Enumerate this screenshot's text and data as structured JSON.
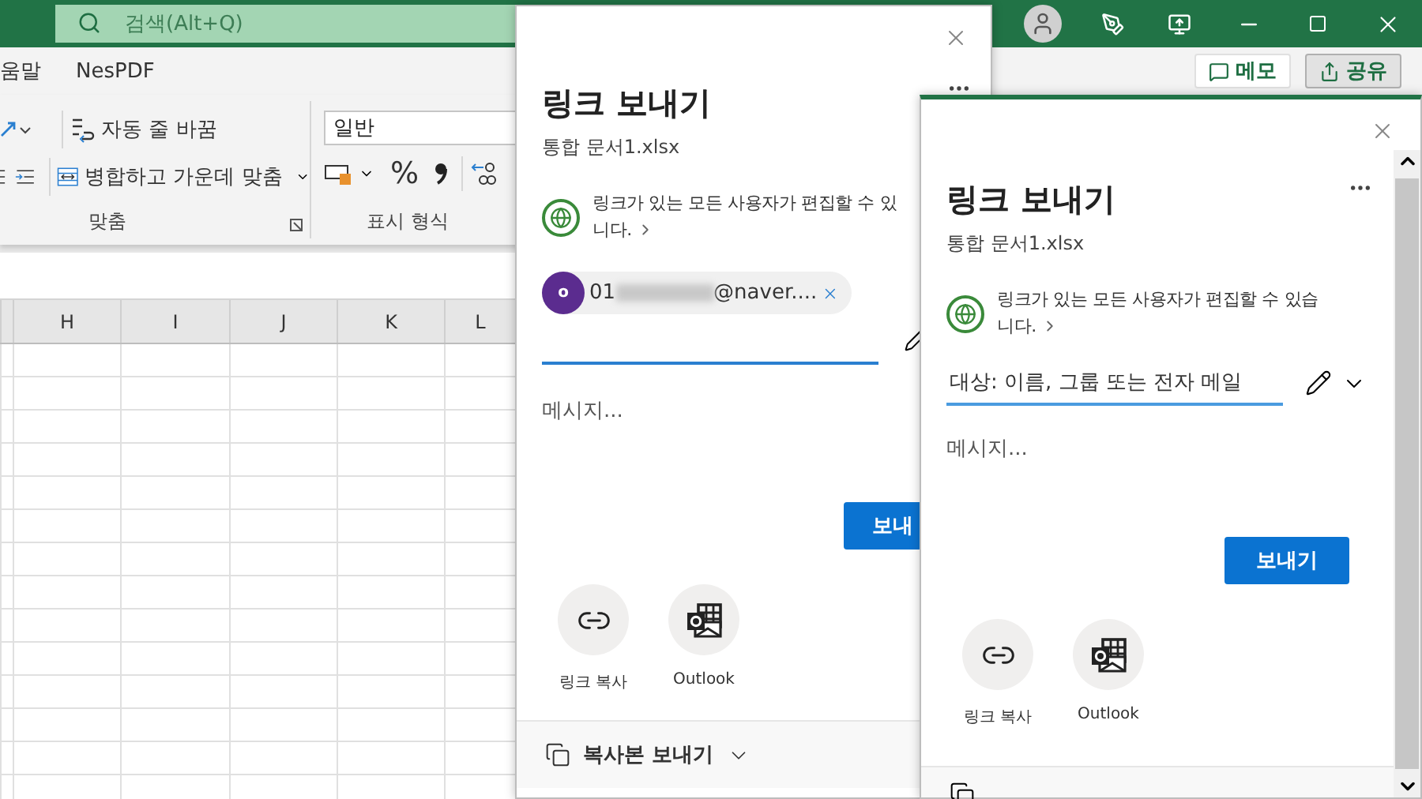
{
  "excel": {
    "search": {
      "placeholder": "검색(Alt+Q)"
    },
    "ribbon_tabs": [
      {
        "label": "움말"
      },
      {
        "label": "NesPDF"
      }
    ],
    "header_buttons": [
      {
        "label": "메모",
        "kind": "comment",
        "selected": false
      },
      {
        "label": "공유",
        "kind": "share",
        "selected": true
      }
    ],
    "ribbon": {
      "wrap_text": "자동 줄 바꿈",
      "merge_center": "병합하고 가운데 맞춤",
      "alignment_group": "맞춤",
      "number_format": "일반",
      "percent": "%",
      "number_group": "표시 형식"
    },
    "columns": [
      "H",
      "I",
      "J",
      "K",
      "L"
    ]
  },
  "dialogs": [
    {
      "title": "링크 보내기",
      "file": "통합 문서1.xlsx",
      "access_lines": [
        "링크가 있는 모든 사용자가 편집할 수 있",
        "니다."
      ],
      "recipient": {
        "initial": "o",
        "prefix": "01",
        "suffix": "@naver...."
      },
      "message_placeholder": "메시지...",
      "send": "보내",
      "options": [
        {
          "label": "링크 복사",
          "kind": "link"
        },
        {
          "label": "Outlook",
          "kind": "outlook"
        }
      ],
      "footer": "복사본 보내기"
    },
    {
      "title": "링크 보내기",
      "file": "통합 문서1.xlsx",
      "access_lines": [
        "링크가 있는 모든 사용자가 편집할 수 있습",
        "니다."
      ],
      "to_placeholder": "대상: 이름, 그룹 또는 전자 메일",
      "message_placeholder": "메시지...",
      "send": "보내기",
      "options": [
        {
          "label": "링크 복사",
          "kind": "link"
        },
        {
          "label": "Outlook",
          "kind": "outlook"
        }
      ]
    }
  ]
}
